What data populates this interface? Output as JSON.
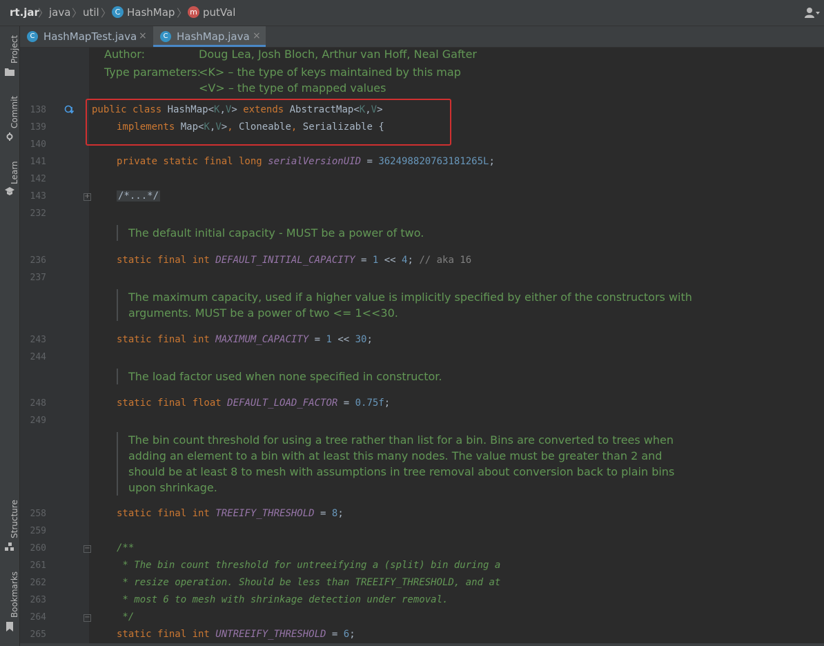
{
  "breadcrumb": {
    "jar": "rt.jar",
    "pkg1": "java",
    "pkg2": "util",
    "cls": "HashMap",
    "cls_badge": "C",
    "method": "putVal",
    "method_badge": "m"
  },
  "toolstrip": {
    "project": "Project",
    "commit": "Commit",
    "learn": "Learn",
    "structure": "Structure",
    "bookmarks": "Bookmarks"
  },
  "tabs": [
    {
      "label": "HashMapTest.java",
      "icon": "class-icon",
      "active": false
    },
    {
      "label": "HashMap.java",
      "icon": "class-icon",
      "active": true
    }
  ],
  "tab_close": "×",
  "editor": {
    "author_label": "Author:",
    "author_value": "Doug Lea, Josh Bloch, Arthur van Hoff, Neal Gafter",
    "typeparams_label": "Type parameters:",
    "typeparam_k": "<K> – the type of keys maintained by this map",
    "typeparam_v": "<V> – the type of mapped values",
    "line_numbers": [
      "138",
      "139",
      "140",
      "141",
      "142",
      "143",
      "232",
      "236",
      "237",
      "243",
      "244",
      "248",
      "249",
      "258",
      "259",
      "260",
      "261",
      "262",
      "263",
      "264",
      "265"
    ],
    "doc_capacity": "The default initial capacity - MUST be a power of two.",
    "doc_max_1": "The maximum capacity, used if a higher value is implicitly specified by either of the constructors with",
    "doc_max_2": "arguments. MUST be a power of two <= 1<<30.",
    "doc_load": "The load factor used when none specified in constructor.",
    "doc_treeify_1": "The bin count threshold for using a tree rather than list for a bin. Bins are converted to trees when",
    "doc_treeify_2": "adding an element to a bin with at least this many nodes. The value must be greater than 2 and",
    "doc_treeify_3": "should be at least 8 to mesh with assumptions in tree removal about conversion back to plain bins",
    "doc_treeify_4": "upon shrinkage.",
    "fold_collapsed": "/*...*/",
    "jd_open": "/**",
    "jd_261": " * The bin count threshold for untreeifying a (split) bin during a",
    "jd_262": " * resize operation. Should be less than TREEIFY_THRESHOLD, and at",
    "jd_263": " * most 6 to mesh with shrinkage detection under removal.",
    "jd_close": " */",
    "comment_aka": "// aka 16",
    "serial_value": "362498820763181265L",
    "capacity_value": "4",
    "max_value": "30",
    "load_value": "0.75f",
    "treeify_value": "8",
    "untreeify_value": "6"
  },
  "colors": {
    "highlight_box": "#d03030",
    "keyword": "#cc7832",
    "static_field": "#9876aa",
    "number": "#6897bb",
    "javadoc": "#629755",
    "active_tab_underline": "#4a88c7"
  }
}
